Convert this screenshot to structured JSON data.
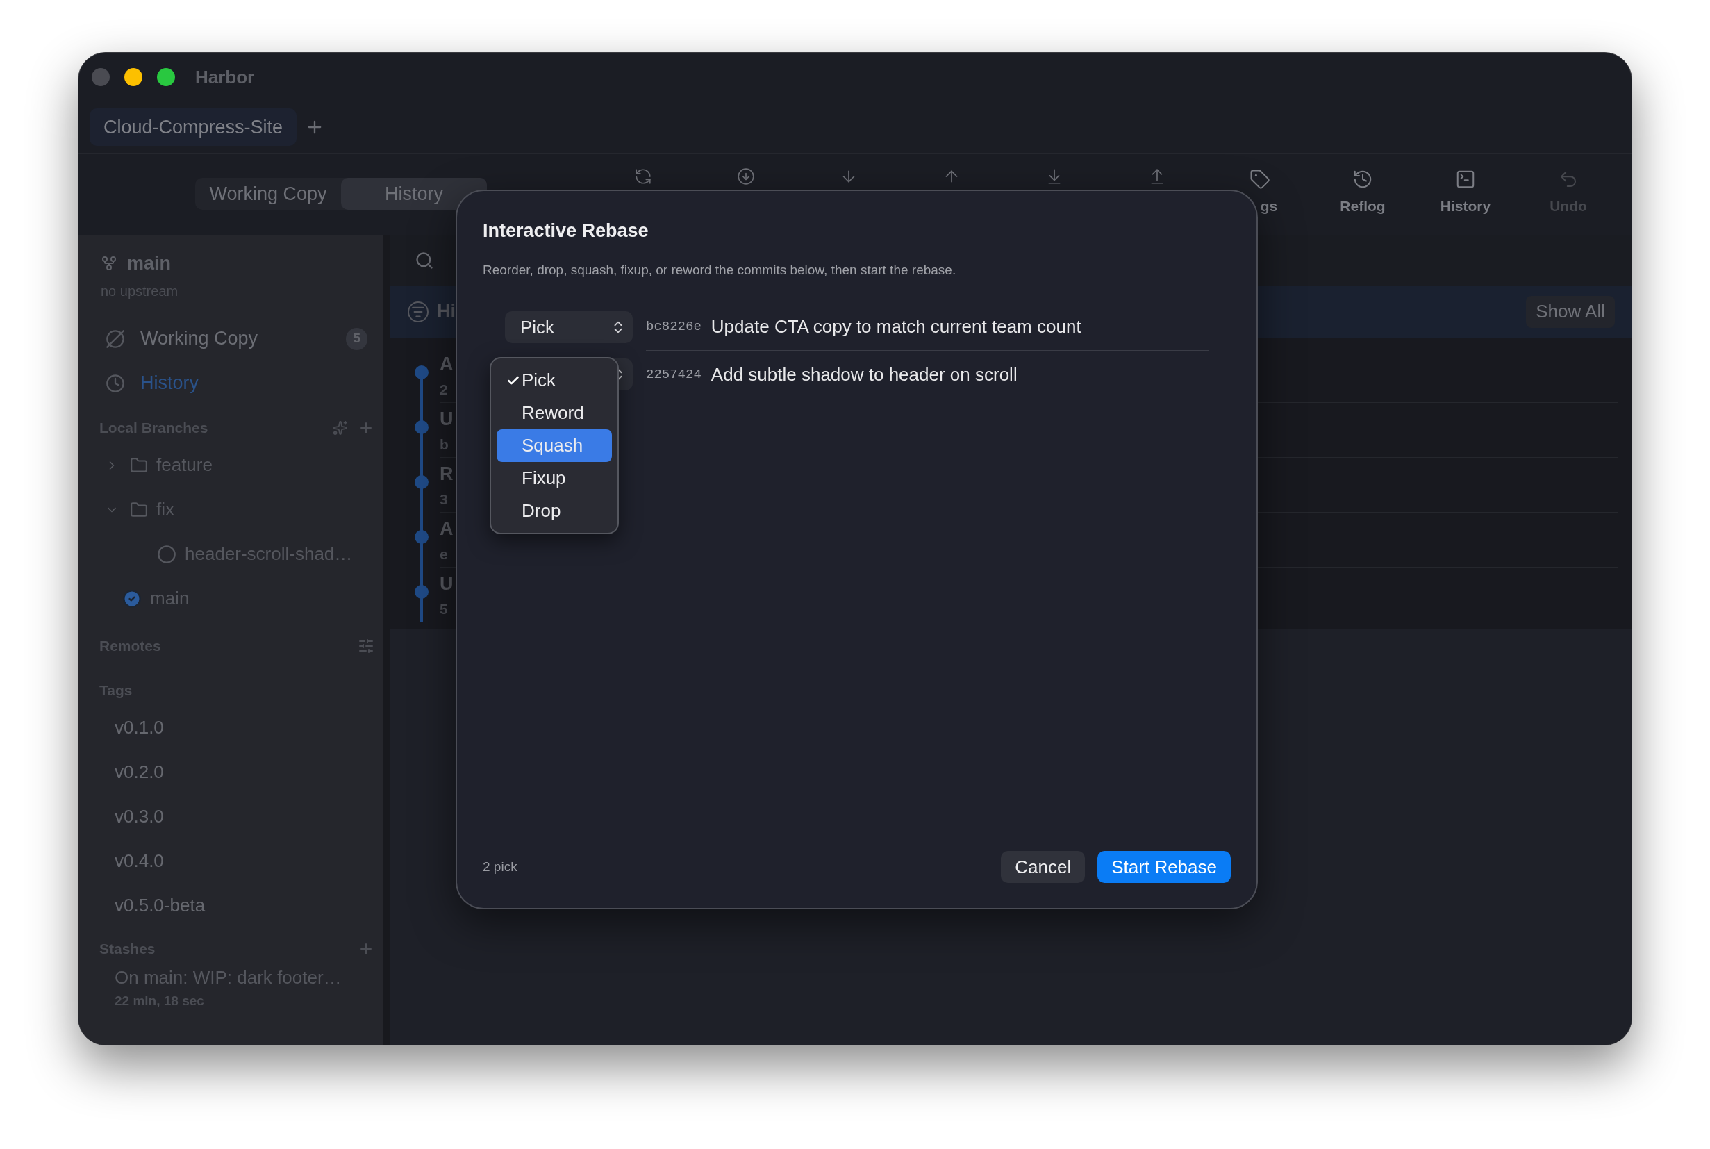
{
  "window": {
    "title": "Harbor"
  },
  "repo_tabs": [
    {
      "label": "Cloud-Compress-Site",
      "selected": true
    }
  ],
  "view_switch": [
    {
      "label": "Working Copy",
      "selected": false
    },
    {
      "label": "History",
      "selected": true
    }
  ],
  "toolbar_buttons": [
    {
      "label": "gs",
      "disabled": false
    },
    {
      "label": "Reflog",
      "disabled": false
    },
    {
      "label": "History",
      "disabled": false
    },
    {
      "label": "Undo",
      "disabled": true
    }
  ],
  "sidebar": {
    "branch": "main",
    "upstream": "no upstream",
    "nav": [
      {
        "label": "Working Copy",
        "badge": "5",
        "selected": false
      },
      {
        "label": "History",
        "selected": true
      }
    ],
    "local_branches": {
      "title": "Local Branches",
      "children": [
        {
          "label": "feature",
          "kind": "folder",
          "expanded": false
        },
        {
          "label": "fix",
          "kind": "folder",
          "expanded": true,
          "children": [
            {
              "label": "header-scroll-shad…",
              "kind": "branch",
              "current": false
            }
          ]
        },
        {
          "label": "main",
          "kind": "branch",
          "current": true
        }
      ]
    },
    "remotes_title": "Remotes",
    "tags_title": "Tags",
    "tags": [
      "v0.1.0",
      "v0.2.0",
      "v0.3.0",
      "v0.4.0",
      "v0.5.0-beta"
    ],
    "stashes_title": "Stashes",
    "stashes": [
      {
        "label": "On main: WIP: dark footer…",
        "time": "22 min, 18 sec"
      }
    ]
  },
  "history_header": {
    "title": "Hi",
    "button": "Show All"
  },
  "commits": [
    {
      "title": "A",
      "meta": "2"
    },
    {
      "title": "U",
      "meta": "b"
    },
    {
      "title": "R",
      "meta": "3"
    },
    {
      "title": "A",
      "meta": "e"
    },
    {
      "title": "U",
      "meta": "5"
    }
  ],
  "dialog": {
    "title": "Interactive Rebase",
    "subtitle": "Reorder, drop, squash, fixup, or reword the commits below, then start the rebase.",
    "rows": [
      {
        "action": "Pick",
        "hash": "bc8226e",
        "message": "Update CTA copy to match current team count"
      },
      {
        "hash": "2257424",
        "message": "Add subtle shadow to header on scroll"
      }
    ],
    "menu": [
      {
        "label": "Pick",
        "checked": true,
        "highlighted": false
      },
      {
        "label": "Reword",
        "checked": false,
        "highlighted": false
      },
      {
        "label": "Squash",
        "checked": false,
        "highlighted": true
      },
      {
        "label": "Fixup",
        "checked": false,
        "highlighted": false
      },
      {
        "label": "Drop",
        "checked": false,
        "highlighted": false
      }
    ],
    "summary": "2 pick",
    "cancel": "Cancel",
    "confirm": "Start Rebase"
  }
}
